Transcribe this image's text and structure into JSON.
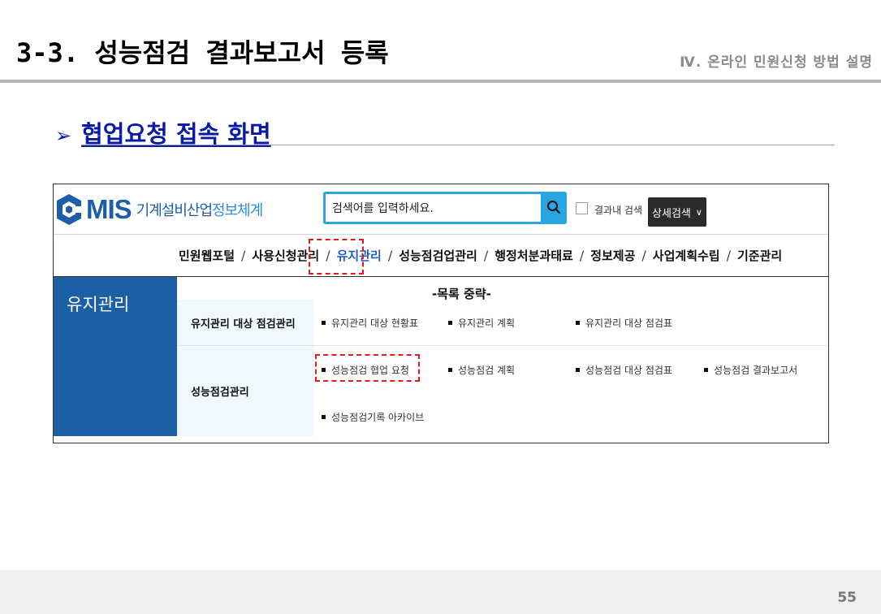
{
  "slide": {
    "title": "3-3. 성능점검 결과보고서 등록",
    "section": "Ⅳ. 온라인 민원신청 방법 설명",
    "sub_heading_arrow": "➢",
    "sub_heading": "협업요청 접속 화면",
    "page_number": "55"
  },
  "screenshot": {
    "logo": {
      "main": "MIS",
      "sub_1": "기계설비산업",
      "sub_2": "정보체계"
    },
    "search": {
      "placeholder": "검색어를 입력하세요."
    },
    "in_result_label": "결과내 검색",
    "advanced_search": "상세검색",
    "menu": [
      "민원웹포털",
      "사용신청관리",
      "유지관리",
      "성능점검업관리",
      "행정처분과태료",
      "정보제공",
      "사업계획수립",
      "기준관리"
    ],
    "menu_separator": "/",
    "active_menu": "유지관리",
    "left_title": "유지관리",
    "omitted_note": "-목록 중략-",
    "rows": [
      {
        "label": "유지관리 대상 점검관리",
        "items": [
          "유지관리 대상 현황표",
          "유지관리 계획",
          "유지관리 대상 점검표"
        ]
      },
      {
        "label": "성능점검관리",
        "items": [
          "성능점검 협업 요청",
          "성능점검 계획",
          "성능점검 대상 점검표",
          "성능점검 결과보고서",
          "성능점검기록 아카이브"
        ]
      }
    ]
  },
  "colors": {
    "heading_blue": "#0a1aa8",
    "brand_blue": "#1b5fa5",
    "search_accent": "#2aa5e0",
    "highlight_red": "#e11a1a"
  },
  "icons": {
    "search": "search-icon",
    "chevron": "chevron-down-icon",
    "logo": "mis-logo-icon"
  }
}
